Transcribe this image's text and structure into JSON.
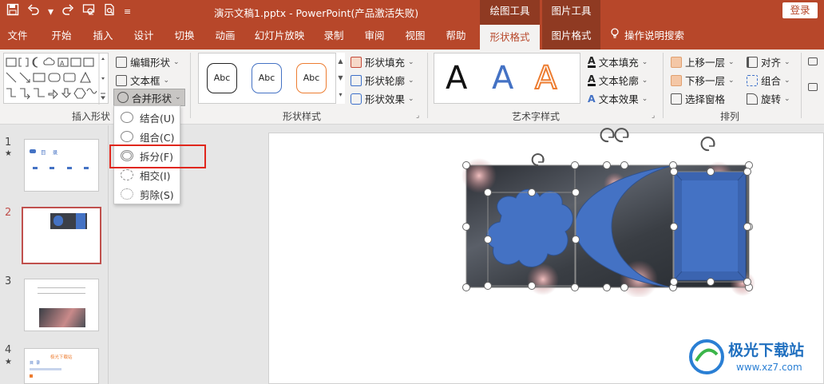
{
  "titlebar": {
    "qat": [
      "save-icon",
      "undo-icon",
      "redo-icon",
      "presenter-icon",
      "print-preview-icon",
      "customize-icon"
    ],
    "title": "演示文稿1.pptx  -  PowerPoint(产品激活失败)",
    "ctx_drawing": "绘图工具",
    "ctx_picture": "图片工具",
    "login": "登录"
  },
  "tabs": [
    "文件",
    "开始",
    "插入",
    "设计",
    "切换",
    "动画",
    "幻灯片放映",
    "录制",
    "审阅",
    "视图",
    "帮助",
    "形状格式",
    "图片格式",
    "操作说明搜索"
  ],
  "ribbon": {
    "insert_shapes": {
      "edit_shape": "编辑形状",
      "text_box": "文本框",
      "merge_shapes": "合并形状",
      "label": "插入形状"
    },
    "shape_styles": {
      "preview_text": "Abc",
      "fill": "形状填充",
      "outline": "形状轮廓",
      "effect": "形状效果",
      "label": "形状样式"
    },
    "wordart": {
      "letter": "A",
      "text_fill": "文本填充",
      "text_outline": "文本轮廓",
      "text_effect": "文本效果",
      "label": "艺术字样式"
    },
    "arrange": {
      "bring_forward": "上移一层",
      "send_backward": "下移一层",
      "selection_pane": "选择窗格",
      "align": "对齐",
      "group": "组合",
      "rotate": "旋转",
      "label": "排列"
    }
  },
  "merge_menu": [
    "结合(U)",
    "组合(C)",
    "拆分(F)",
    "相交(I)",
    "剪除(S)"
  ],
  "slides": [
    {
      "num": "1",
      "star": "★",
      "title": "目    录"
    },
    {
      "num": "2",
      "star": ""
    },
    {
      "num": "3",
      "star": ""
    },
    {
      "num": "4",
      "star": "★",
      "title": "极光下载站",
      "sub": "目  录"
    }
  ],
  "watermark": {
    "name": "极光下载站",
    "url": "www.xz7.com"
  },
  "colors": {
    "accent": "#b7472a",
    "context": "#8f3a22",
    "shape_blue": "#4472c4",
    "highlight": "#e0261c"
  }
}
